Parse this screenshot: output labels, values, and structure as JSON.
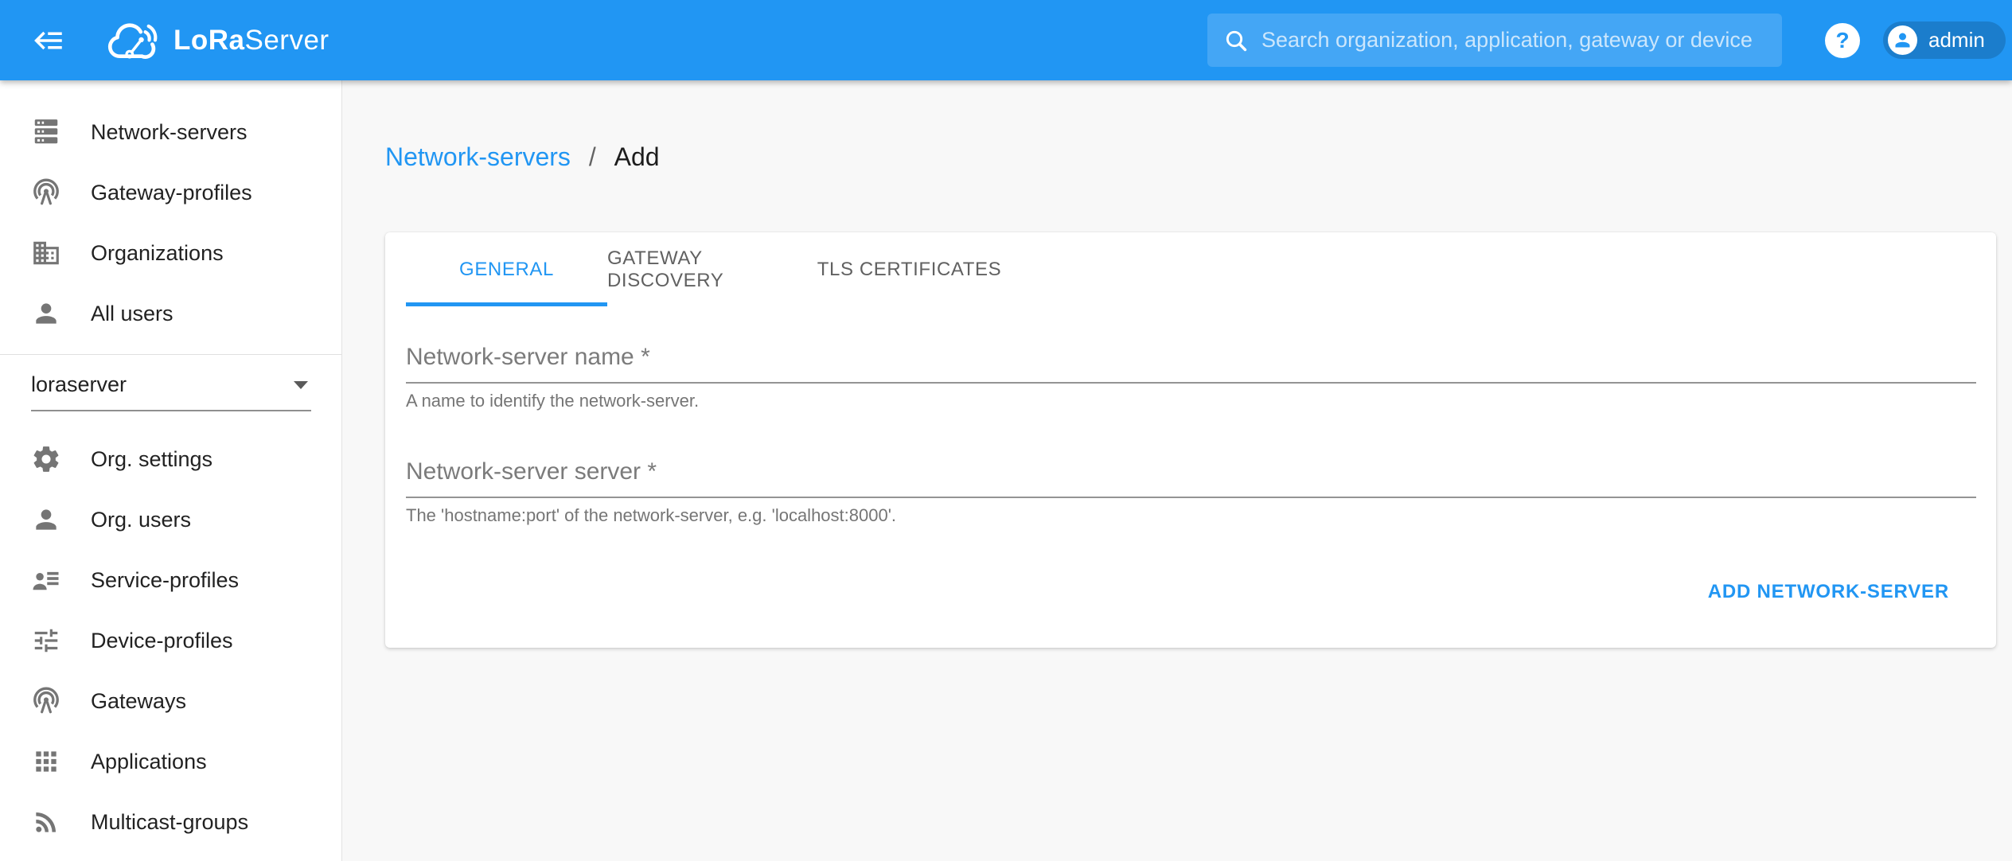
{
  "header": {
    "logo_bold": "LoRa",
    "logo_regular": "Server",
    "search_placeholder": "Search organization, application, gateway or device",
    "help_label": "?",
    "user_name": "admin"
  },
  "sidebar": {
    "global_items": [
      {
        "label": "Network-servers",
        "icon": "server-icon"
      },
      {
        "label": "Gateway-profiles",
        "icon": "access-point-icon"
      },
      {
        "label": "Organizations",
        "icon": "building-icon"
      },
      {
        "label": "All users",
        "icon": "person-icon"
      }
    ],
    "org_selector": {
      "value": "loraserver"
    },
    "org_items": [
      {
        "label": "Org. settings",
        "icon": "gear-icon"
      },
      {
        "label": "Org. users",
        "icon": "person-icon"
      },
      {
        "label": "Service-profiles",
        "icon": "account-details-icon"
      },
      {
        "label": "Device-profiles",
        "icon": "tune-icon"
      },
      {
        "label": "Gateways",
        "icon": "access-point-icon"
      },
      {
        "label": "Applications",
        "icon": "apps-grid-icon"
      },
      {
        "label": "Multicast-groups",
        "icon": "rss-icon"
      }
    ]
  },
  "breadcrumb": {
    "parent": "Network-servers",
    "separator": "/",
    "current": "Add"
  },
  "tabs": [
    {
      "label": "GENERAL",
      "active": true
    },
    {
      "label": "GATEWAY DISCOVERY",
      "active": false
    },
    {
      "label": "TLS CERTIFICATES",
      "active": false
    }
  ],
  "form": {
    "fields": [
      {
        "label": "Network-server name *",
        "value": "",
        "helper": "A name to identify the network-server."
      },
      {
        "label": "Network-server server *",
        "value": "",
        "helper": "The 'hostname:port' of the network-server, e.g. 'localhost:8000'."
      }
    ],
    "submit_label": "ADD NETWORK-SERVER"
  },
  "colors": {
    "primary": "#2196f3",
    "icon-gray": "#757575",
    "bg": "#f8f8f8"
  }
}
